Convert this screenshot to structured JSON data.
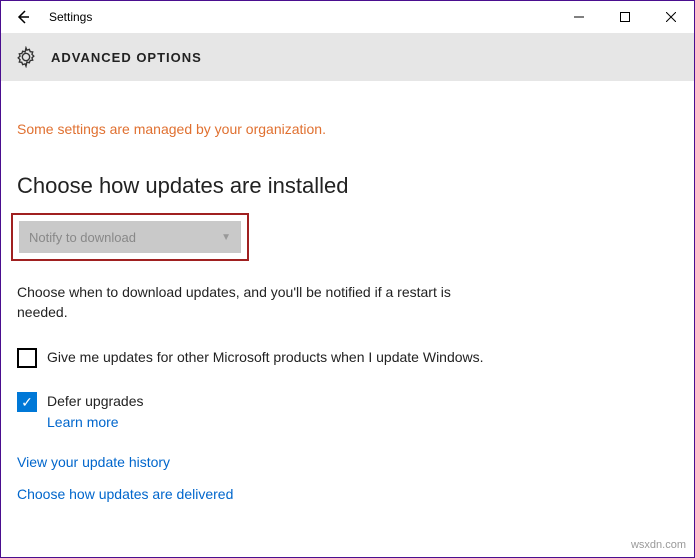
{
  "titlebar": {
    "title": "Settings"
  },
  "header": {
    "title": "ADVANCED OPTIONS"
  },
  "managed_notice": "Some settings are managed by your organization.",
  "section": {
    "heading": "Choose how updates are installed",
    "dropdown_value": "Notify to download",
    "description": "Choose when to download updates, and you'll be notified if a restart is needed."
  },
  "checkboxes": {
    "other_products": {
      "label": "Give me updates for other Microsoft products when I update Windows.",
      "checked": false
    },
    "defer": {
      "label": "Defer upgrades",
      "learn_more": "Learn more",
      "checked": true
    }
  },
  "links": {
    "history": "View your update history",
    "delivery": "Choose how updates are delivered"
  },
  "watermark": "wsxdn.com"
}
